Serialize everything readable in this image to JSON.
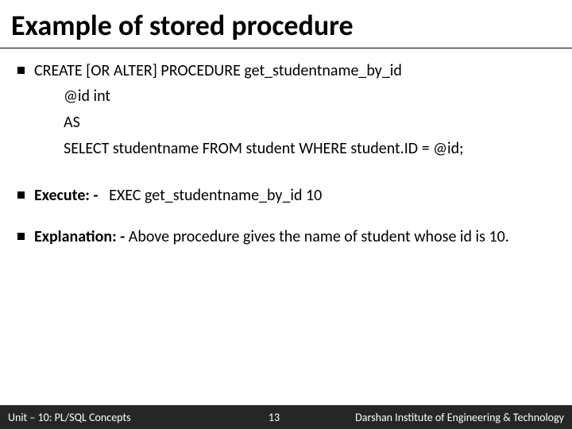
{
  "title": "Example of stored procedure",
  "bullets": {
    "b1": "CREATE [OR ALTER] PROCEDURE get_studentname_by_id",
    "b1_line2": "@id int",
    "b1_line3": "AS",
    "b1_line4": "SELECT studentname FROM student WHERE student.ID = @id;",
    "execute_label": "Execute: -",
    "execute_cmd": "   EXEC get_studentname_by_id 10",
    "explanation_label": "Explanation: -",
    "explanation_text": " Above procedure gives the name of student whose id is 10."
  },
  "footer": {
    "left": "Unit – 10: PL/SQL Concepts",
    "page": "13",
    "right": "Darshan Institute of Engineering & Technology"
  }
}
